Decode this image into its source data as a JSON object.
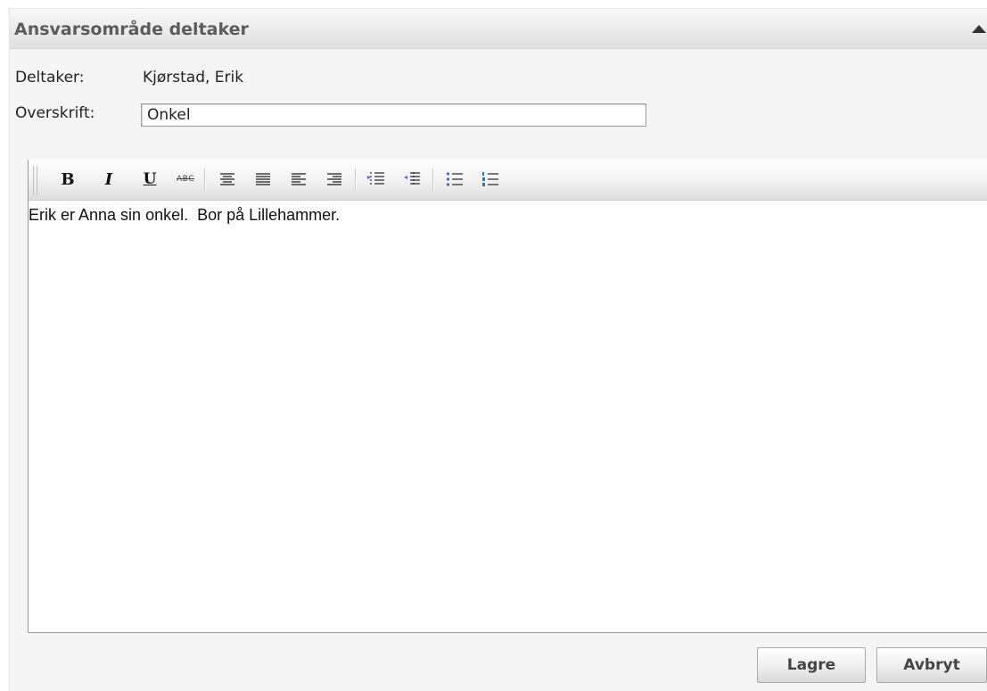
{
  "panel": {
    "title": "Ansvarsområde deltaker"
  },
  "participant": {
    "label": "Deltaker:",
    "value": "Kjørstad, Erik"
  },
  "heading": {
    "label": "Overskrift:",
    "value": "Onkel"
  },
  "toolbar": {
    "bold": "B",
    "italic": "I",
    "underline": "U",
    "strikethrough": "ABC"
  },
  "editor": {
    "content": "Erik er Anna sin onkel.  Bor på Lillehammer."
  },
  "actions": {
    "save_label": "Lagre",
    "cancel_label": "Avbryt"
  }
}
